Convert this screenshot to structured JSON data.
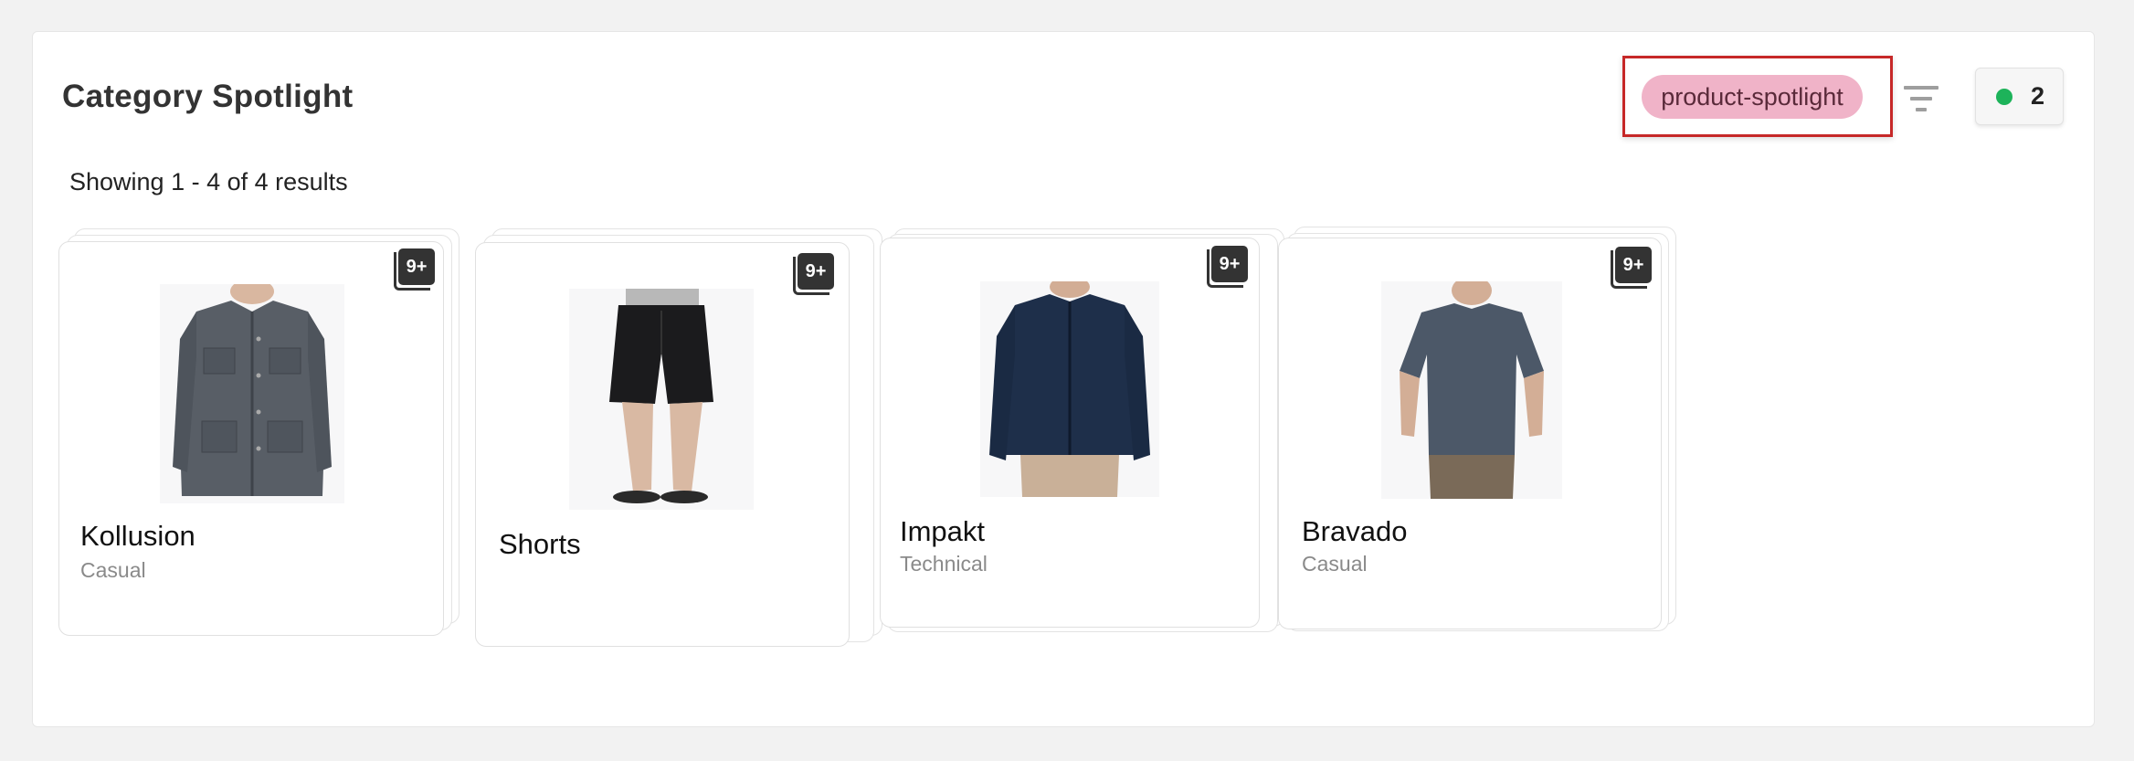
{
  "page": {
    "title": "Category Spotlight",
    "results_text": "Showing 1 - 4 of 4 results"
  },
  "header": {
    "tag_label": "product-spotlight",
    "status_count": "2",
    "colors": {
      "tag_bg": "#f0b3c8",
      "highlight_border": "#c62828",
      "status_dot": "#1db35a"
    }
  },
  "cards": [
    {
      "name": "Kollusion",
      "category": "Casual",
      "badge": "9+",
      "image": "gray-jacket-icon"
    },
    {
      "name": "Shorts",
      "category": "",
      "badge": "9+",
      "image": "black-shorts-icon"
    },
    {
      "name": "Impakt",
      "category": "Technical",
      "badge": "9+",
      "image": "navy-jacket-icon"
    },
    {
      "name": "Bravado",
      "category": "Casual",
      "badge": "9+",
      "image": "gray-tshirt-icon"
    }
  ]
}
